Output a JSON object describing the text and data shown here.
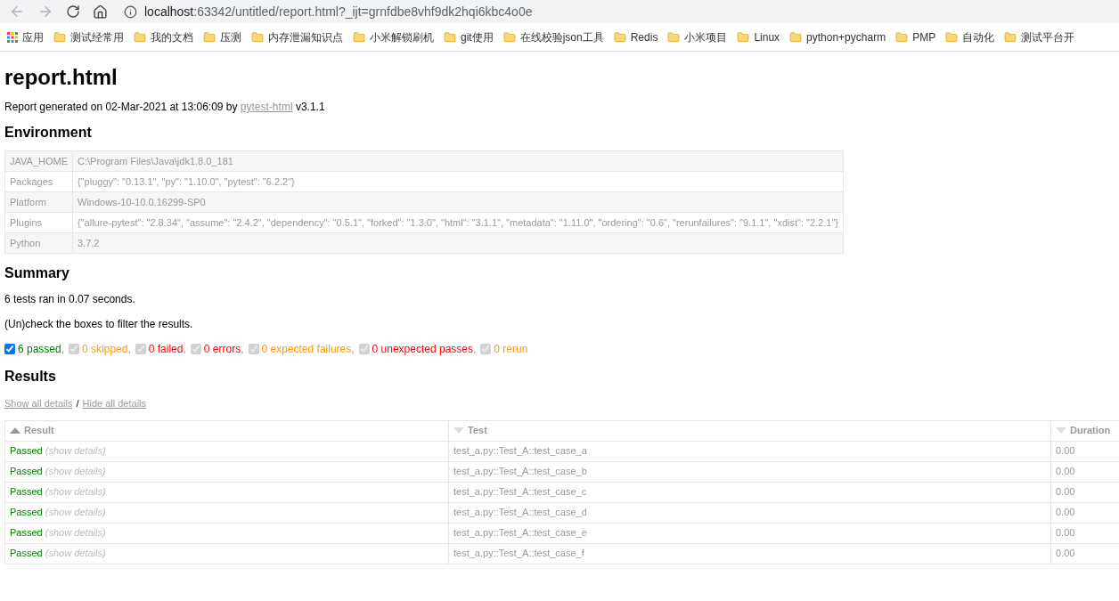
{
  "browser": {
    "url_host": "localhost",
    "url_rest": ":63342/untitled/report.html?_ijt=grnfdbe8vhf9dk2hqi6kbc4o0e"
  },
  "bookmarks": [
    {
      "kind": "apps",
      "label": "应用"
    },
    {
      "kind": "folder",
      "label": "测试经常用"
    },
    {
      "kind": "folder",
      "label": "我的文档"
    },
    {
      "kind": "folder",
      "label": "压测"
    },
    {
      "kind": "folder",
      "label": "内存泄漏知识点"
    },
    {
      "kind": "folder",
      "label": "小米解锁刷机"
    },
    {
      "kind": "folder",
      "label": "git使用"
    },
    {
      "kind": "folder",
      "label": "在线校验json工具"
    },
    {
      "kind": "folder",
      "label": "Redis"
    },
    {
      "kind": "folder",
      "label": "小米项目"
    },
    {
      "kind": "folder",
      "label": "Linux"
    },
    {
      "kind": "folder",
      "label": "python+pycharm"
    },
    {
      "kind": "folder",
      "label": "PMP"
    },
    {
      "kind": "folder",
      "label": "自动化"
    },
    {
      "kind": "folder",
      "label": "测试平台开"
    }
  ],
  "title": "report.html",
  "generated": {
    "before": "Report generated on 02-Mar-2021 at 13:06:09 by",
    "link": "pytest-html",
    "after": "v3.1.1"
  },
  "environment": {
    "heading": "Environment",
    "rows": [
      {
        "key": "JAVA_HOME",
        "value": "C:\\Program Files\\Java\\jdk1.8.0_181"
      },
      {
        "key": "Packages",
        "value": "{\"pluggy\": \"0.13.1\", \"py\": \"1.10.0\", \"pytest\": \"6.2.2\"}"
      },
      {
        "key": "Platform",
        "value": "Windows-10-10.0.16299-SP0"
      },
      {
        "key": "Plugins",
        "value": "{\"allure-pytest\": \"2.8.34\", \"assume\": \"2.4.2\", \"dependency\": \"0.5.1\", \"forked\": \"1.3.0\", \"html\": \"3.1.1\", \"metadata\": \"1.11.0\", \"ordering\": \"0.6\", \"rerunfailures\": \"9.1.1\", \"xdist\": \"2.2.1\"}"
      },
      {
        "key": "Python",
        "value": "3.7.2"
      }
    ]
  },
  "summary": {
    "heading": "Summary",
    "ran": "6 tests ran in 0.07 seconds.",
    "hint": "(Un)check the boxes to filter the results.",
    "filters": [
      {
        "label": "6 passed",
        "separator": ",",
        "checked": true,
        "disabled": false,
        "color": "#008000"
      },
      {
        "label": "0 skipped",
        "separator": ",",
        "checked": true,
        "disabled": true,
        "color": "#ff9900"
      },
      {
        "label": "0 failed",
        "separator": ",",
        "checked": true,
        "disabled": true,
        "color": "#ff0000"
      },
      {
        "label": "0 errors",
        "separator": ",",
        "checked": true,
        "disabled": true,
        "color": "#ff0000"
      },
      {
        "label": "0 expected failures",
        "separator": ",",
        "checked": true,
        "disabled": true,
        "color": "#ff9900"
      },
      {
        "label": "0 unexpected passes",
        "separator": ",",
        "checked": true,
        "disabled": true,
        "color": "#ff0000"
      },
      {
        "label": "0 rerun",
        "checked": true,
        "disabled": true,
        "color": "#ff9900"
      }
    ]
  },
  "results": {
    "heading": "Results",
    "show_all": "Show all details",
    "separator": "/",
    "hide_all": "Hide all details",
    "columns": [
      {
        "label": "Result",
        "sorted": true
      },
      {
        "label": "Test",
        "sorted": false
      },
      {
        "label": "Duration",
        "sorted": false
      }
    ],
    "rows": [
      {
        "result": "Passed",
        "details": "(show details)",
        "test": "test_a.py::Test_A::test_case_a",
        "duration": "0.00"
      },
      {
        "result": "Passed",
        "details": "(show details)",
        "test": "test_a.py::Test_A::test_case_b",
        "duration": "0.00"
      },
      {
        "result": "Passed",
        "details": "(show details)",
        "test": "test_a.py::Test_A::test_case_c",
        "duration": "0.00"
      },
      {
        "result": "Passed",
        "details": "(show details)",
        "test": "test_a.py::Test_A::test_case_d",
        "duration": "0.00"
      },
      {
        "result": "Passed",
        "details": "(show details)",
        "test": "test_a.py::Test_A::test_case_e",
        "duration": "0.00"
      },
      {
        "result": "Passed",
        "details": "(show details)",
        "test": "test_a.py::Test_A::test_case_f",
        "duration": "0.00"
      }
    ]
  }
}
